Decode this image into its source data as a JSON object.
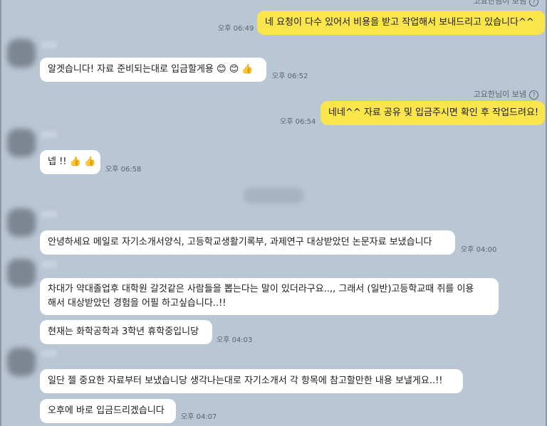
{
  "header_partial": {
    "text": "고요한님이 보냄"
  },
  "messages": [
    {
      "side": "me",
      "text": "네 요청이 다수 있어서 비용을 받고 작업해서 보내드리고 있습니다^^",
      "time": "오후 06:49"
    },
    {
      "side": "them",
      "text": "알겟습니다! 자료 준비되는대로 입금할게용 😊 😊 👍",
      "time": "오후 06:52"
    },
    {
      "side": "me",
      "sender": "고요한님이 보냄",
      "text": "네네^^ 자료 공유 및 입금주시면 확인 후 작업드려요!",
      "time": "오후 06:54"
    },
    {
      "side": "them",
      "text": "넵 !! 👍 👍",
      "time": "오후 06:58"
    },
    {
      "side": "them",
      "text": "안녕하세요 메일로 자기소개서양식, 고등학교생활기록부, 과제연구 대상받았던 논문자료 보냈습니다",
      "time": "오후 04:00"
    },
    {
      "side": "them",
      "line1": "차대가 약대졸업후 대학원 갈것같은 사람들을 뽑는다는 말이 있더라구요..,, 그래서 (일반)고등학교때 쥐를 이용",
      "line2": "해서 대상받았던 경험을 어필 하고싶습니다..!!"
    },
    {
      "side": "them",
      "text": "현재는 화학공학과 3학년 휴학중입니당",
      "time": "오후 04:03"
    },
    {
      "side": "them",
      "text": "일단 젤 중요한 자료부터 보냈습니당 생각나는대로 자기소개서 각 항목에 참고할만한 내용 보낼게요..!!"
    },
    {
      "side": "them",
      "text": "오후에 바로 입금드리겠습니다",
      "time": "오후 04:07"
    }
  ],
  "icons": {
    "help": "?"
  },
  "colors": {
    "background": "#b9c6d4",
    "my_bubble": "#fbe54d",
    "their_bubble": "#ffffff"
  }
}
